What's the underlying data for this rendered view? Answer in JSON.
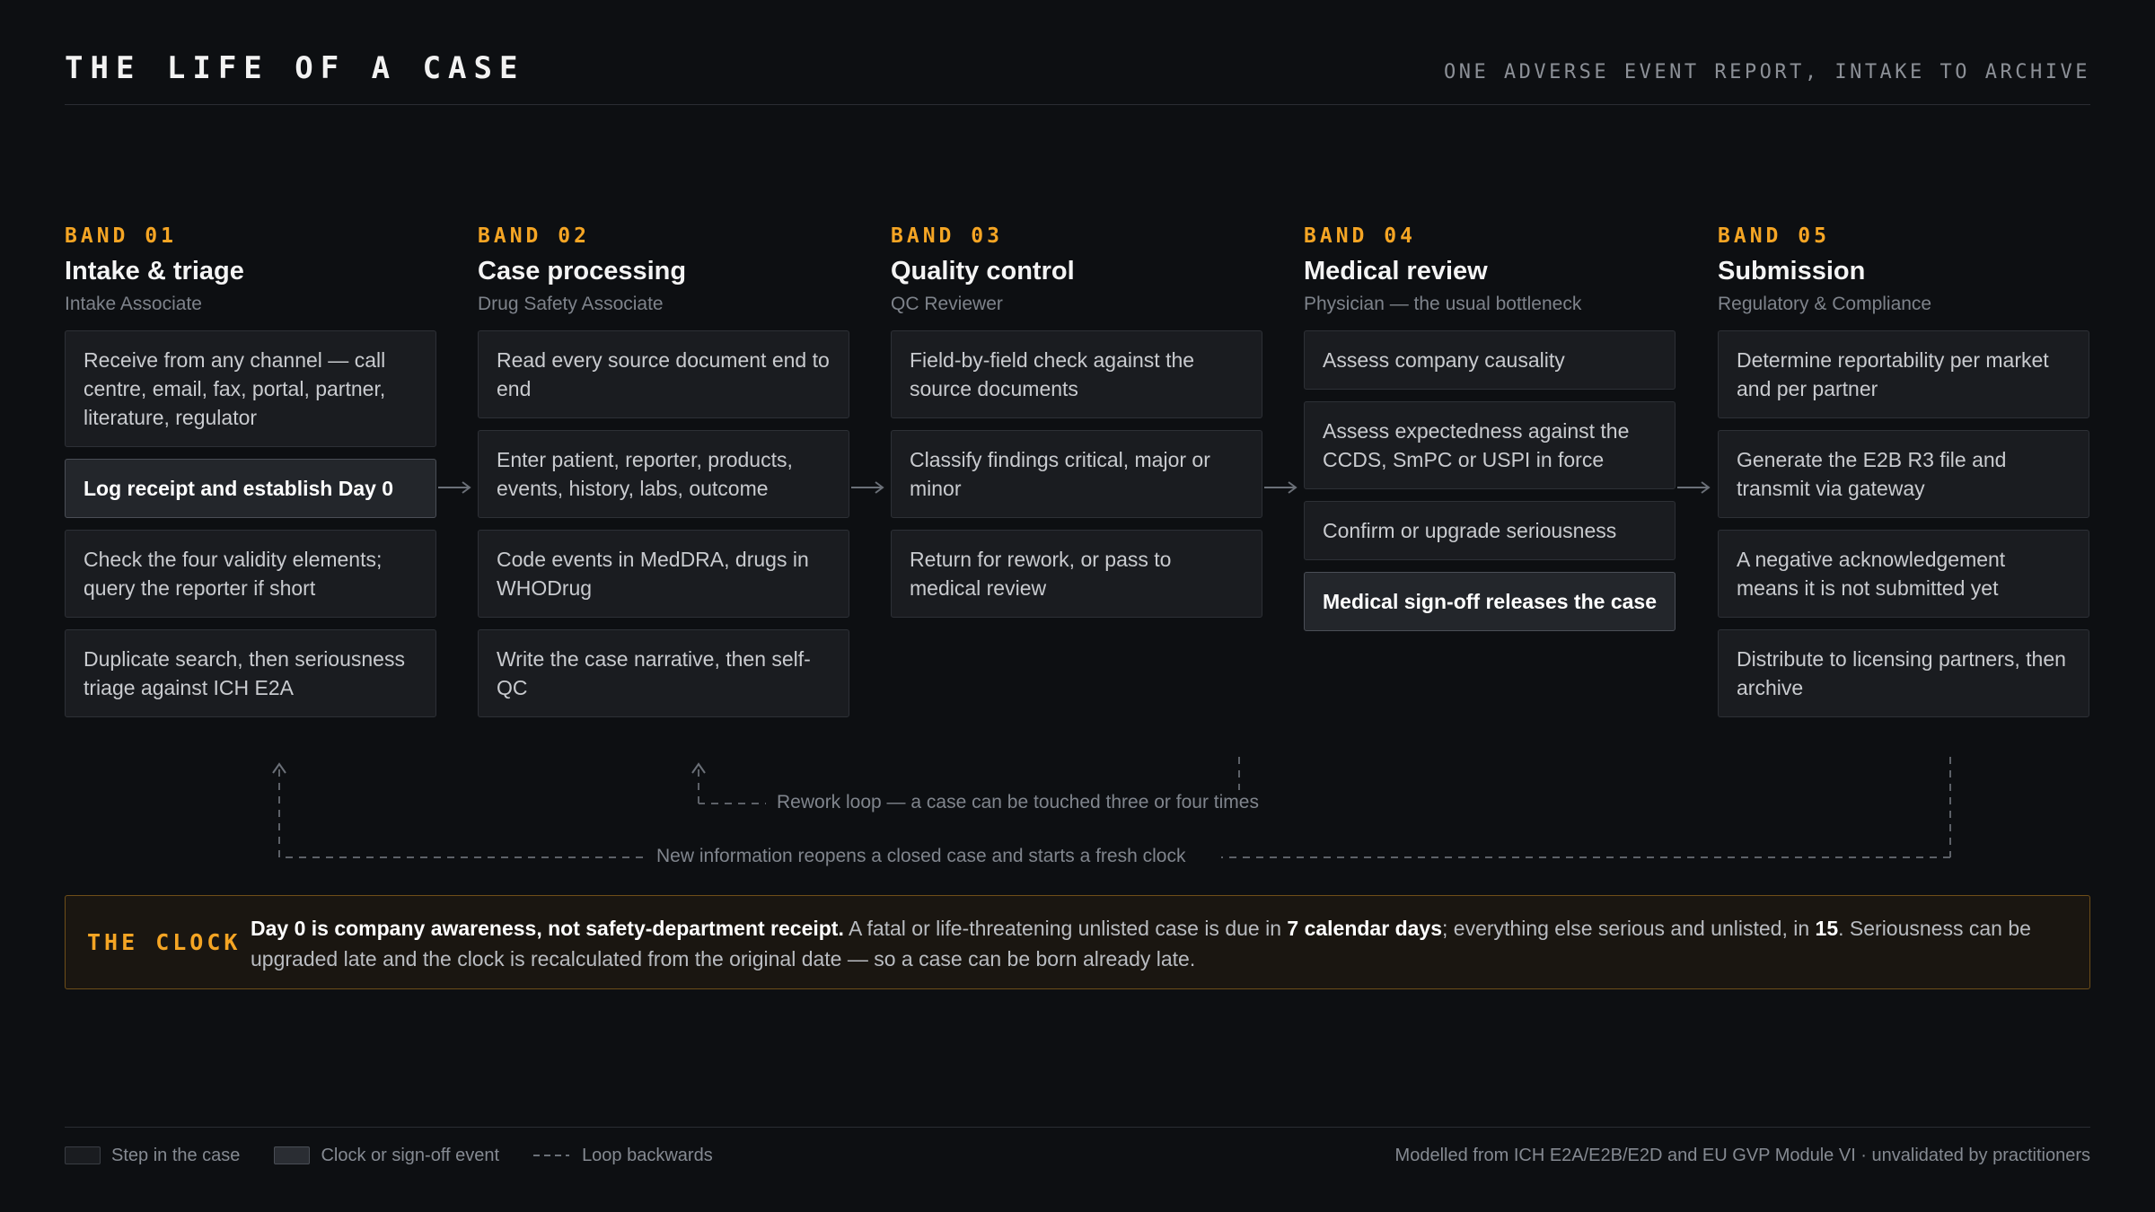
{
  "header": {
    "title": "THE LIFE OF A CASE",
    "subtitle": "ONE ADVERSE EVENT REPORT, INTAKE TO ARCHIVE"
  },
  "bands": [
    {
      "number": "BAND 01",
      "name": "Intake & triage",
      "role": "Intake Associate",
      "steps": [
        {
          "text": "Receive from any channel — call centre, email, fax, portal, partner, literature, regulator",
          "kind": "step"
        },
        {
          "text": "Log receipt and establish Day 0",
          "kind": "event"
        },
        {
          "text": "Check the four validity elements; query the reporter if short",
          "kind": "step"
        },
        {
          "text": "Duplicate search, then seriousness triage against ICH E2A",
          "kind": "step"
        }
      ]
    },
    {
      "number": "BAND 02",
      "name": "Case processing",
      "role": "Drug Safety Associate",
      "steps": [
        {
          "text": "Read every source document end to end",
          "kind": "step"
        },
        {
          "text": "Enter patient, reporter, products, events, history, labs, outcome",
          "kind": "step"
        },
        {
          "text": "Code events in MedDRA, drugs in WHODrug",
          "kind": "step"
        },
        {
          "text": "Write the case narrative, then self-QC",
          "kind": "step"
        }
      ]
    },
    {
      "number": "BAND 03",
      "name": "Quality control",
      "role": "QC Reviewer",
      "steps": [
        {
          "text": "Field-by-field check against the source documents",
          "kind": "step"
        },
        {
          "text": "Classify findings critical, major or minor",
          "kind": "step"
        },
        {
          "text": "Return for rework, or pass to medical review",
          "kind": "step"
        }
      ]
    },
    {
      "number": "BAND 04",
      "name": "Medical review",
      "role": "Physician — the usual bottleneck",
      "steps": [
        {
          "text": "Assess company causality",
          "kind": "step"
        },
        {
          "text": "Assess expectedness against the CCDS, SmPC or USPI in force",
          "kind": "step"
        },
        {
          "text": "Confirm or upgrade seriousness",
          "kind": "step"
        },
        {
          "text": "Medical sign-off releases the case",
          "kind": "event"
        }
      ]
    },
    {
      "number": "BAND 05",
      "name": "Submission",
      "role": "Regulatory & Compliance",
      "steps": [
        {
          "text": "Determine reportability per market and per partner",
          "kind": "step"
        },
        {
          "text": "Generate the E2B R3 file and transmit via gateway",
          "kind": "step"
        },
        {
          "text": "A negative acknowledgement means it is not submitted yet",
          "kind": "step"
        },
        {
          "text": "Distribute to licensing partners, then archive",
          "kind": "step"
        }
      ]
    }
  ],
  "loops": {
    "rework": "Rework loop — a case can be touched three or four times",
    "reopen": "New information reopens a closed case and starts a fresh clock"
  },
  "clock": {
    "label": "THE CLOCK",
    "lead": "Day 0 is company awareness, not safety-department receipt.",
    "part1": " A fatal or life-threatening unlisted case is due in ",
    "days_fatal": "7 calendar days",
    "part2": "; everything else serious and unlisted, in ",
    "days_other": "15",
    "part3": ". Seriousness can be upgraded late and the clock is recalculated from the original date — so a case can be born already late."
  },
  "legend": {
    "step": "Step in the case",
    "event": "Clock or sign-off event",
    "loop_symbol": "- - -",
    "loop": "Loop backwards"
  },
  "footer": {
    "credit": "Modelled from ICH E2A/E2B/E2D and EU GVP Module VI · unvalidated by practitioners"
  },
  "colors": {
    "accent": "#f5a524",
    "background": "#0d0f12",
    "card": "#1a1c20"
  }
}
